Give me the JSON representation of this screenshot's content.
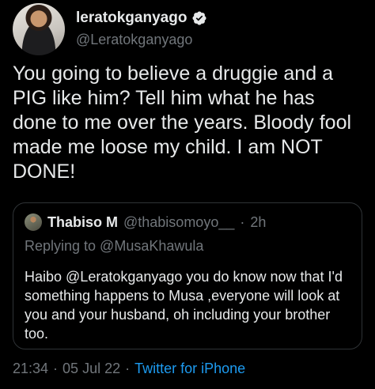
{
  "author": {
    "display_name": "leratokganyago",
    "handle": "@Leratokganyago",
    "verified_icon": "verified-badge-icon",
    "verified_color": "#e7e9ea"
  },
  "tweet": {
    "text": "You going to believe a druggie and a PIG like him? Tell him what he has done to me over the years. Bloody fool made me loose my child. I am NOT DONE!"
  },
  "quote": {
    "display_name": "Thabiso M",
    "handle": "@thabisomoyo__",
    "separator": "·",
    "time": "2h",
    "replying_to": "Replying to @MusaKhawula",
    "text": "Haibo @Leratokganyago you do know now that I'd something happens to Musa ,everyone will look at you and your husband, oh including your brother too."
  },
  "meta": {
    "time": "21:34",
    "separator": "·",
    "date": "05 Jul 22",
    "client": "Twitter for iPhone"
  },
  "colors": {
    "background": "#000000",
    "primary_text": "#e7e9ea",
    "secondary_text": "#71767b",
    "link": "#1d9bf0",
    "border": "#2f3336"
  }
}
